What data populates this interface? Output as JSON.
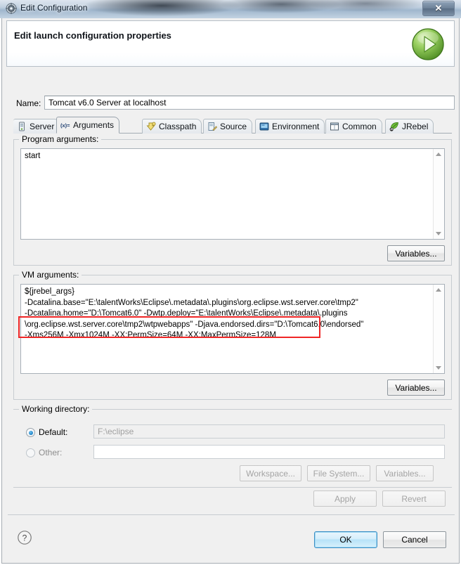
{
  "window": {
    "title": "Edit Configuration",
    "title_icon": "gear-icon",
    "close_label": "✕"
  },
  "banner": {
    "title": "Edit launch configuration properties",
    "icon": "run-green-play-icon"
  },
  "name_row": {
    "label": "Name:",
    "value": "Tomcat v6.0 Server at localhost"
  },
  "tabs": [
    {
      "label": "Server",
      "icon": "server-icon",
      "active": false
    },
    {
      "label": "Arguments",
      "icon": "variable-xy-icon",
      "active": true
    },
    {
      "label": "Classpath",
      "icon": "classpath-icon",
      "active": false
    },
    {
      "label": "Source",
      "icon": "source-icon",
      "active": false
    },
    {
      "label": "Environment",
      "icon": "environment-icon",
      "active": false
    },
    {
      "label": "Common",
      "icon": "common-icon",
      "active": false
    },
    {
      "label": "JRebel",
      "icon": "jrebel-leaf-icon",
      "active": false
    }
  ],
  "program_arguments": {
    "group_label": "Program arguments:",
    "value": "start",
    "variables_button": "Variables..."
  },
  "vm_arguments": {
    "group_label": "VM arguments:",
    "value": "${jrebel_args}\n-Dcatalina.base=\"E:\\talentWorks\\Eclipse\\.metadata\\.plugins\\org.eclipse.wst.server.core\\tmp2\"\n-Dcatalina.home=\"D:\\Tomcat6.0\" -Dwtp.deploy=\"E:\\talentWorks\\Eclipse\\.metadata\\.plugins\n\\org.eclipse.wst.server.core\\tmp2\\wtpwebapps\" -Djava.endorsed.dirs=\"D:\\Tomcat6.0\\endorsed\"\n-Xms256M -Xmx1024M -XX:PermSize=64M -XX:MaxPermSize=128M",
    "variables_button": "Variables...",
    "highlight_color": "#ef2626",
    "highlighted_text": "-Xms256M -Xmx1024M -XX:PermSize=64M -XX:MaxPermSize=128M"
  },
  "working_directory": {
    "group_label": "Working directory:",
    "default_radio_label": "Default:",
    "default_radio_selected": true,
    "default_value": "F:\\eclipse",
    "other_radio_label": "Other:",
    "other_radio_selected": false,
    "other_value": "",
    "workspace_button": "Workspace...",
    "file_system_button": "File System...",
    "variables_button": "Variables..."
  },
  "footer": {
    "apply_button": "Apply",
    "revert_button": "Revert",
    "help_icon": "help-question-icon",
    "ok_button": "OK",
    "cancel_button": "Cancel"
  }
}
